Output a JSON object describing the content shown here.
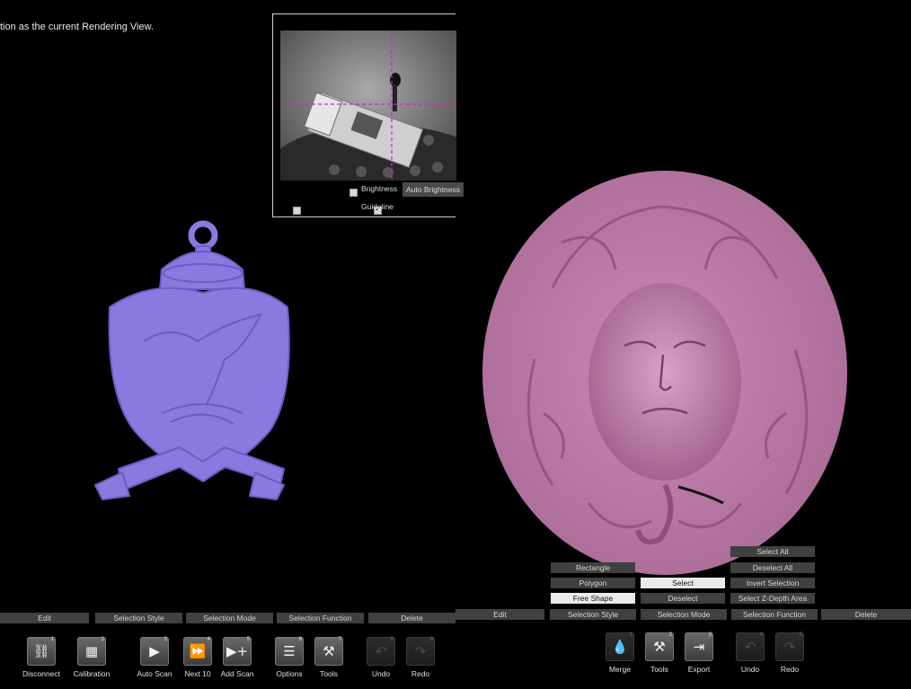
{
  "hint_text": "tion as the current Rendering View.",
  "camera": {
    "brightness_label": "Brightness",
    "brightness_checked": false,
    "auto_brightness_label": "Auto Brightness",
    "guideline_label": "Guideline",
    "guideline_checked": true,
    "crosshair_color": "#d020d0"
  },
  "colors": {
    "pendant": "#8a7ae0",
    "medusa": "#c07aa8",
    "accent": "#d020d0"
  },
  "left_bar": [
    "Edit",
    "Selection Style",
    "Selection Mode",
    "Selection Function",
    "Delete"
  ],
  "right_bar": [
    "Edit",
    "Selection Style",
    "Selection Mode",
    "Selection Function",
    "Delete"
  ],
  "selection_style": [
    "Rectangle",
    "Polygon",
    "Free Shape"
  ],
  "selection_mode": [
    "Select",
    "Deselect"
  ],
  "selection_function": [
    "Select All",
    "Deselect All",
    "Invert Selection",
    "Select Z-Depth Area"
  ],
  "left_tools": [
    {
      "label": "Disconnect",
      "num": "1",
      "icon": "unlink-icon"
    },
    {
      "label": "Calibration",
      "num": "2",
      "icon": "calibration-grid-icon"
    },
    {
      "label": "Auto Scan",
      "num": "3",
      "icon": "play-icon"
    },
    {
      "label": "Next 10",
      "num": "4",
      "icon": "fast-forward-icon"
    },
    {
      "label": "Add Scan",
      "num": "5",
      "icon": "add-scan-icon"
    },
    {
      "label": "Options",
      "num": "6",
      "icon": "sliders-icon"
    },
    {
      "label": "Tools",
      "num": "7",
      "icon": "tools-icon"
    },
    {
      "label": "Undo",
      "num": "8",
      "icon": "undo-icon"
    },
    {
      "label": "Redo",
      "num": "9",
      "icon": "redo-icon"
    }
  ],
  "right_tools": [
    {
      "label": "Merge",
      "num": "1",
      "icon": "merge-drop-icon"
    },
    {
      "label": "Tools",
      "num": "2",
      "icon": "tools-icon"
    },
    {
      "label": "Export",
      "num": "3",
      "icon": "export-icon"
    },
    {
      "label": "Undo",
      "num": "4",
      "icon": "undo-icon"
    },
    {
      "label": "Redo",
      "num": "5",
      "icon": "redo-icon"
    }
  ]
}
